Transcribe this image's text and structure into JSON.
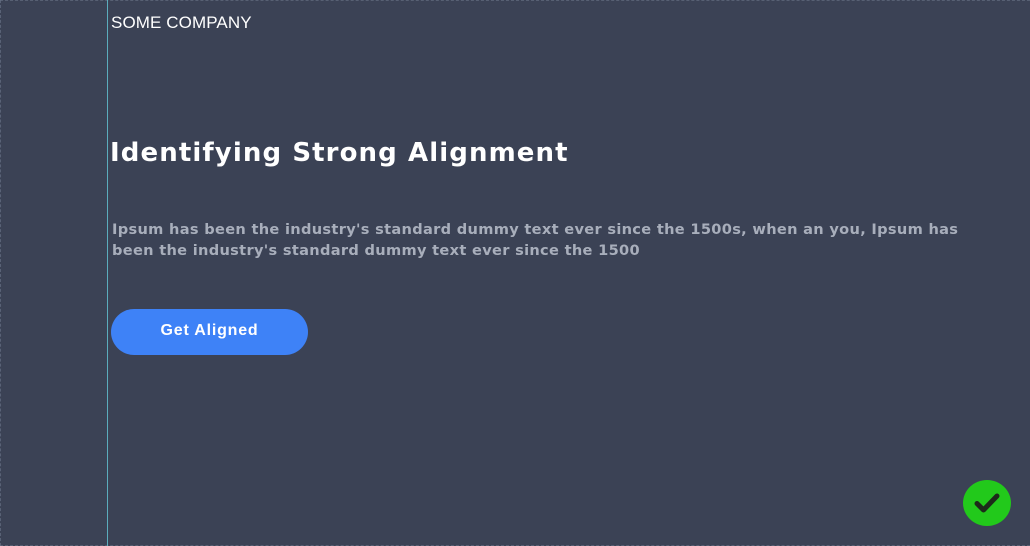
{
  "header": {
    "company_name": "SOME COMPANY"
  },
  "hero": {
    "title": "Identifying Strong Alignment",
    "description": "Ipsum has been the industry's standard dummy text ever since the 1500s, when an you, Ipsum has been the industry's standard dummy text ever since the 1500",
    "cta_label": "Get Aligned"
  },
  "status": {
    "icon": "checkmark-icon",
    "color": "#22c91b"
  },
  "colors": {
    "background": "#3b4255",
    "accent": "#3e82f7",
    "guide": "#5fb9c9"
  }
}
